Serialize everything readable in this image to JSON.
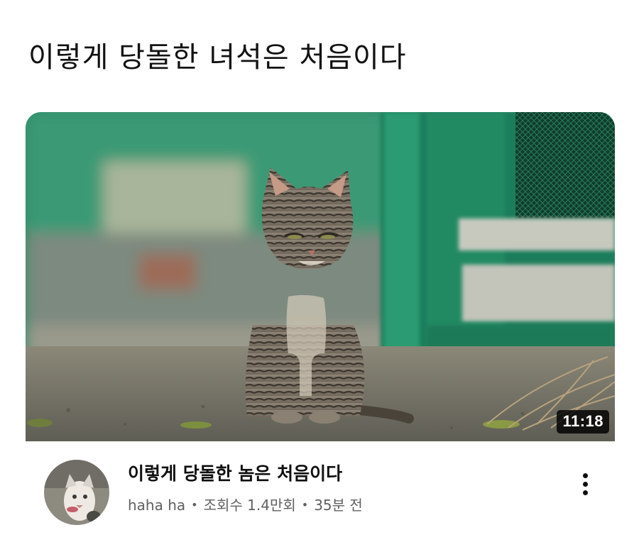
{
  "post": {
    "title": "이렇게 당돌한 녀석은 처음이다"
  },
  "video": {
    "duration": "11:18",
    "title": "이렇게 당돌한 놈은 처음이다",
    "channel": "haha ha",
    "separator": "•",
    "views": "조회수 1.4만회",
    "age": "35분 전"
  },
  "icons": {
    "more": "more-vert-icon",
    "avatar": "cat-avatar"
  },
  "colors": {
    "background": "#ffffff",
    "title_text": "#111111",
    "meta_text": "#606060",
    "badge_bg": "#000000"
  }
}
